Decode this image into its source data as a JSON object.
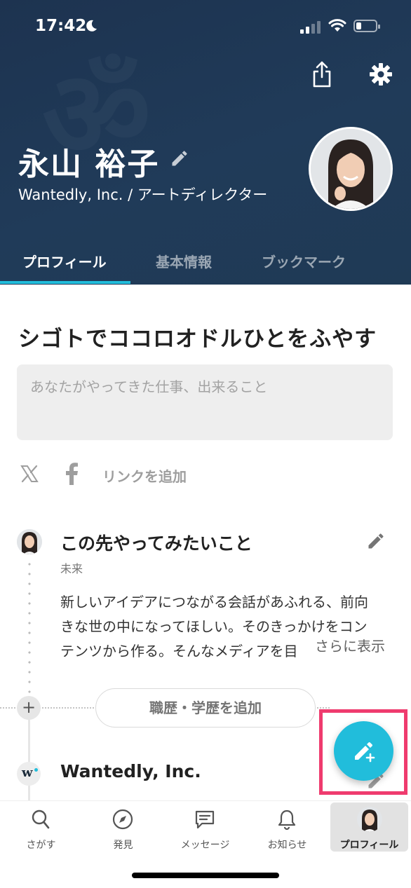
{
  "status_bar": {
    "time": "17:42",
    "battery_level": 0.25
  },
  "header": {
    "name": "永山 裕子",
    "company_role": "Wantedly, Inc. / アートディレクター"
  },
  "tabs": [
    {
      "label": "プロフィール",
      "active": true
    },
    {
      "label": "基本情報",
      "active": false
    },
    {
      "label": "ブックマーク",
      "active": false
    }
  ],
  "profile": {
    "headline": "シゴトでココロオドルひとをふやす",
    "description_placeholder": "あなたがやってきた仕事、出来ること",
    "add_link_label": "リンクを追加"
  },
  "future_card": {
    "title": "この先やってみたいこと",
    "subtitle": "未来",
    "body_lines": [
      "新しいアイデアにつながる会話があふれる、前向",
      "きな世の中になってほしい。そのきっかけをコン",
      "テンツから作る。そんなメディアを目"
    ],
    "see_more": "さらに表示"
  },
  "add_career_label": "職歴・学歴を追加",
  "career": {
    "company": "Wantedly, Inc."
  },
  "bottom_nav": [
    {
      "label": "さがす",
      "icon": "search-icon"
    },
    {
      "label": "発見",
      "icon": "compass-icon"
    },
    {
      "label": "メッセージ",
      "icon": "message-icon"
    },
    {
      "label": "お知らせ",
      "icon": "bell-icon"
    },
    {
      "label": "プロフィール",
      "icon": "profile-avatar-icon",
      "active": true
    }
  ],
  "colors": {
    "header_bg": "#1f3756",
    "accent": "#21bddb",
    "highlight": "#ef3b6e"
  }
}
